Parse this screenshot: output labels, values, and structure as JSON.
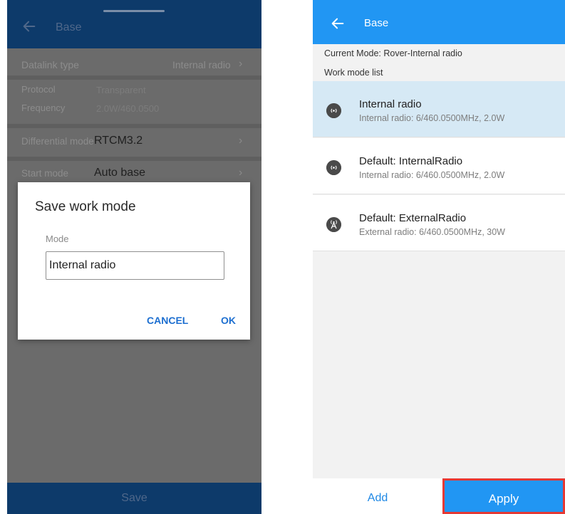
{
  "left": {
    "title": "Base",
    "datalink_type_label": "Datalink type",
    "datalink_type_value": "Internal radio",
    "protocol_label": "Protocol",
    "protocol_value": "Transparent",
    "frequency_label": "Frequency",
    "frequency_value": "2.0W/460.0500",
    "diff_mode_label": "Differential mode",
    "diff_mode_value": "RTCM3.2",
    "start_mode_label": "Start mode",
    "start_mode_value": "Auto base",
    "save_label": "Save",
    "dialog": {
      "title": "Save work mode",
      "mode_label": "Mode",
      "mode_value": "Internal radio",
      "cancel_label": "CANCEL",
      "ok_label": "OK"
    }
  },
  "right": {
    "title": "Base",
    "current_mode": "Current Mode: Rover-Internal radio",
    "list_header": "Work mode list",
    "modes": [
      {
        "title": "Internal radio",
        "subtitle": "Internal radio: 6/460.0500MHz, 2.0W",
        "icon": "radio-icon",
        "selected": true
      },
      {
        "title": "Default: InternalRadio",
        "subtitle": "Internal radio: 6/460.0500MHz, 2.0W",
        "icon": "radio-icon",
        "selected": false
      },
      {
        "title": "Default: ExternalRadio",
        "subtitle": "External radio: 6/460.0500MHz, 30W",
        "icon": "antenna-icon",
        "selected": false
      }
    ],
    "add_label": "Add",
    "apply_label": "Apply"
  },
  "colors": {
    "appbar_dark": "#0d3a6a",
    "appbar_blue": "#2196f3",
    "accent_link": "#1d6fd0",
    "highlight_border": "#e53935",
    "selected_row": "#d6e9f5"
  }
}
